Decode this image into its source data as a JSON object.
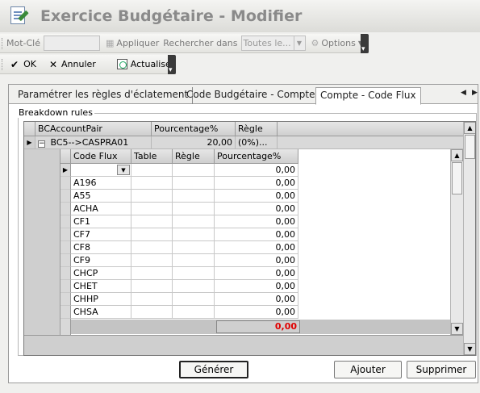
{
  "window": {
    "title": "Exercice Budgétaire - Modifier"
  },
  "toolbar1": {
    "keyword_label": "Mot-Clé",
    "keyword_value": "",
    "apply_label": "Appliquer",
    "search_in_label": "Rechercher dans",
    "search_in_value": "Toutes le...",
    "options_label": "Options"
  },
  "toolbar2": {
    "ok_label": "OK",
    "cancel_label": "Annuler",
    "refresh_label": "Actualiser"
  },
  "tabs": [
    {
      "label": "Paramétrer les règles d'éclatement",
      "active": false
    },
    {
      "label": "Code Budgétaire - Compte",
      "active": false
    },
    {
      "label": "Compte - Code Flux",
      "active": true
    }
  ],
  "group": {
    "label": "Breakdown rules"
  },
  "outer_grid": {
    "columns": [
      "BCAccountPair",
      "Pourcentage%",
      "Règle"
    ],
    "row": {
      "expander": "−",
      "pair": "BC5-->CASPRA01",
      "percent": "20,00",
      "rule": "(0%)..."
    }
  },
  "inner_grid": {
    "columns": [
      "Code Flux",
      "Table",
      "Règle",
      "Pourcentage%"
    ],
    "new_row_percent": "0,00",
    "rows": [
      {
        "code": "A196",
        "percent": "0,00"
      },
      {
        "code": "A55",
        "percent": "0,00"
      },
      {
        "code": "ACHA",
        "percent": "0,00"
      },
      {
        "code": "CF1",
        "percent": "0,00"
      },
      {
        "code": "CF7",
        "percent": "0,00"
      },
      {
        "code": "CF8",
        "percent": "0,00"
      },
      {
        "code": "CF9",
        "percent": "0,00"
      },
      {
        "code": "CHCP",
        "percent": "0,00"
      },
      {
        "code": "CHET",
        "percent": "0,00"
      },
      {
        "code": "CHHP",
        "percent": "0,00"
      },
      {
        "code": "CHSA",
        "percent": "0,00"
      }
    ],
    "total": "0,00"
  },
  "buttons": {
    "generate": "Générer",
    "add": "Ajouter",
    "delete": "Supprimer"
  },
  "colors": {
    "total_text": "#e00000",
    "title_text": "#8a8a8a"
  }
}
